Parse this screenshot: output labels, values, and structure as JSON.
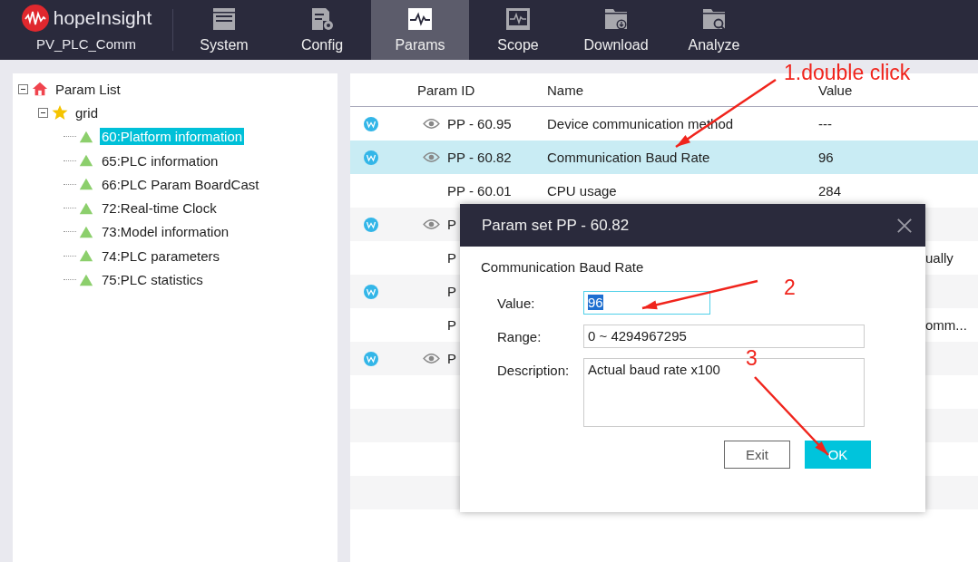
{
  "app": {
    "name": "hopeInsight",
    "project": "PV_PLC_Comm"
  },
  "tabs": [
    {
      "label": "System",
      "selected": false
    },
    {
      "label": "Config",
      "selected": false
    },
    {
      "label": "Params",
      "selected": true
    },
    {
      "label": "Scope",
      "selected": false
    },
    {
      "label": "Download",
      "selected": false
    },
    {
      "label": "Analyze",
      "selected": false
    }
  ],
  "tree": {
    "label": "Param List",
    "expanded": true,
    "children": [
      {
        "label": "grid",
        "expanded": true,
        "children": [
          {
            "label": "60:Platform information",
            "selected": true
          },
          {
            "label": "65:PLC information",
            "selected": false
          },
          {
            "label": "66:PLC Param BoardCast",
            "selected": false
          },
          {
            "label": "72:Real-time Clock",
            "selected": false
          },
          {
            "label": "73:Model information",
            "selected": false
          },
          {
            "label": "74:PLC parameters",
            "selected": false
          },
          {
            "label": "75:PLC statistics",
            "selected": false
          }
        ]
      }
    ]
  },
  "table": {
    "columns": [
      "Param ID",
      "Name",
      "Value"
    ],
    "rows": [
      {
        "writable": true,
        "watch": true,
        "param_id": "PP - 60.95",
        "name": "Device communication method",
        "value": "---",
        "selected": false
      },
      {
        "writable": true,
        "watch": true,
        "param_id": "PP - 60.82",
        "name": "Communication Baud Rate",
        "value": "96",
        "selected": true
      },
      {
        "writable": false,
        "watch": false,
        "param_id": "PP - 60.01",
        "name": "CPU usage",
        "value": "284",
        "selected": false
      },
      {
        "writable": true,
        "watch": true,
        "param_id": "P",
        "selected": false
      },
      {
        "writable": false,
        "watch": false,
        "param_id": "P",
        "tail": "ually",
        "selected": false
      },
      {
        "writable": true,
        "watch": false,
        "param_id": "P",
        "selected": false
      },
      {
        "writable": false,
        "watch": false,
        "param_id": "P",
        "tail": "omm...",
        "selected": false
      },
      {
        "writable": true,
        "watch": true,
        "param_id": "P",
        "selected": false
      }
    ]
  },
  "dialog": {
    "title": "Param set PP - 60.82",
    "subtitle": "Communication Baud Rate",
    "fields": [
      {
        "label": "Value:",
        "value": "96",
        "kind": "input",
        "focused": true
      },
      {
        "label": "Range:",
        "value": "0 ~ 4294967295",
        "kind": "input",
        "focused": false
      },
      {
        "label": "Description:",
        "value": "Actual baud rate x100",
        "kind": "textarea",
        "focused": false
      }
    ],
    "buttons": [
      {
        "label": "Exit",
        "kind": "secondary"
      },
      {
        "label": "OK",
        "kind": "primary"
      }
    ]
  },
  "annotations": [
    {
      "text": "1.double click"
    },
    {
      "text": "2"
    },
    {
      "text": "3"
    }
  ]
}
